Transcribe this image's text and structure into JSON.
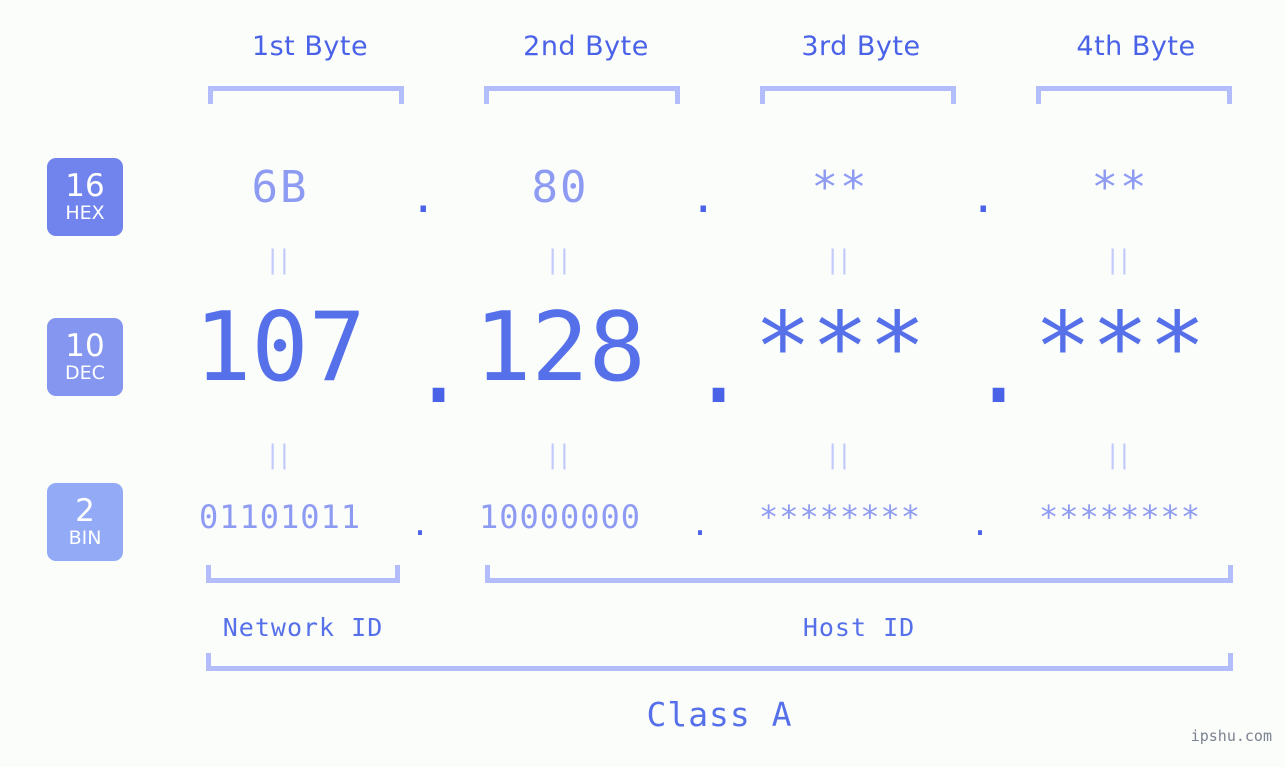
{
  "meta": {
    "background_color": "#fbfdfa",
    "accent_color": "#5670ea",
    "light_accent_color": "#8e9bf2",
    "bracket_color": "#b3bdfb",
    "watermark": "ipshu.com"
  },
  "headers": {
    "byte_labels": [
      "1st Byte",
      "2nd Byte",
      "3rd Byte",
      "4th Byte"
    ]
  },
  "radix_badges": [
    {
      "number": "16",
      "name": "HEX",
      "color": "#7183ec"
    },
    {
      "number": "10",
      "name": "DEC",
      "color": "#8496f0"
    },
    {
      "number": "2",
      "name": "BIN",
      "color": "#93aaf6"
    }
  ],
  "separator": {
    "glyph": "||"
  },
  "rows": {
    "hex": {
      "radix": "16",
      "radix_name": "HEX",
      "bytes": [
        "6B",
        "80",
        "**",
        "**"
      ],
      "dot": "."
    },
    "dec": {
      "radix": "10",
      "radix_name": "DEC",
      "bytes": [
        "107",
        "128",
        "***",
        "***"
      ],
      "dot": "."
    },
    "bin": {
      "radix": "2",
      "radix_name": "BIN",
      "bytes": [
        "01101011",
        "10000000",
        "********",
        "********"
      ],
      "dot": "."
    }
  },
  "footer": {
    "network_id_label": "Network ID",
    "host_id_label": "Host ID",
    "class_label": "Class A"
  }
}
